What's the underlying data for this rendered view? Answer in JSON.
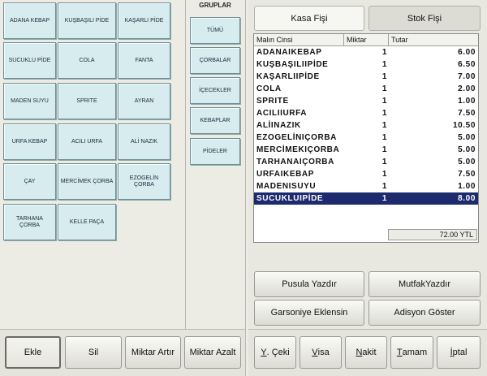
{
  "products": [
    [
      "ADANA KEBAP",
      "KUŞBAŞILI PİDE",
      "KAŞARLI PİDE"
    ],
    [
      "SUCUKLU PİDE",
      "COLA",
      "FANTA"
    ],
    [
      "MADEN SUYU",
      "SPRITE",
      "AYRAN"
    ],
    [
      "URFA KEBAP",
      "ACILI URFA",
      "ALİ NAZIK"
    ],
    [
      "ÇAY",
      "MERCİMEK ÇORBA",
      "EZOGELİN ÇORBA"
    ],
    [
      "TARHANA ÇORBA",
      "KELLE PAÇA"
    ]
  ],
  "groups": {
    "title": "GRUPLAR",
    "items": [
      "TÜMÜ",
      "ÇORBALAR",
      "İÇECEKLER",
      "KEBAPLAR",
      "PİDELER"
    ]
  },
  "left_actions": {
    "add": "Ekle",
    "delete": "Sil",
    "qty_up": "Miktar Artır",
    "qty_down": "Miktar Azalt"
  },
  "tabs": {
    "kasa": "Kasa Fişi",
    "stok": "Stok Fişi"
  },
  "receipt": {
    "columns": [
      "Malın Cinsi",
      "Miktar",
      "Tutar"
    ],
    "rows": [
      {
        "name": "ADANAIKEBAP",
        "qty": "1",
        "amount": "6.00"
      },
      {
        "name": "KUŞBAŞILIIPİDE",
        "qty": "1",
        "amount": "6.50"
      },
      {
        "name": "KAŞARLIIPİDE",
        "qty": "1",
        "amount": "7.00"
      },
      {
        "name": "COLA",
        "qty": "1",
        "amount": "2.00"
      },
      {
        "name": "SPRITE",
        "qty": "1",
        "amount": "1.00"
      },
      {
        "name": "ACILIIURFA",
        "qty": "1",
        "amount": "7.50"
      },
      {
        "name": "ALİINAZIK",
        "qty": "1",
        "amount": "10.50"
      },
      {
        "name": "EZOGELİNIÇORBA",
        "qty": "1",
        "amount": "5.00"
      },
      {
        "name": "MERCİMEKIÇORBA",
        "qty": "1",
        "amount": "5.00"
      },
      {
        "name": "TARHANAIÇORBA",
        "qty": "1",
        "amount": "5.00"
      },
      {
        "name": "URFAIKEBAP",
        "qty": "1",
        "amount": "7.50"
      },
      {
        "name": "MADENISUYU",
        "qty": "1",
        "amount": "1.00"
      },
      {
        "name": "SUCUKLUIPİDE",
        "qty": "1",
        "amount": "8.00",
        "selected": true
      }
    ],
    "total": "72.00 YTL"
  },
  "right_actions": {
    "print_slip": "Pusula Yazdır",
    "kitchen_print": "MutfakYazdır",
    "add_to_waiter": "Garsoniye Eklensin",
    "show_bill": "Adisyon Göster"
  },
  "payment": {
    "check": "Y. Çeki",
    "visa": "Visa",
    "cash": "Nakit",
    "done": "Tamam",
    "cancel": "İptal"
  }
}
